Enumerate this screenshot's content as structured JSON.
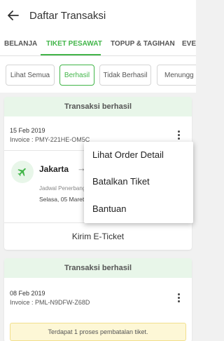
{
  "header": {
    "title": "Daftar Transaksi",
    "back_icon": "arrow-left-icon"
  },
  "tabs": [
    {
      "label": "BELANJA",
      "active": false
    },
    {
      "label": "TIKET PESAWAT",
      "active": true
    },
    {
      "label": "TOPUP & TAGIHAN",
      "active": false
    },
    {
      "label": "EVEN",
      "active": false
    }
  ],
  "filters": [
    {
      "label": "Lihat Semua",
      "active": false
    },
    {
      "label": "Berhasil",
      "active": true
    },
    {
      "label": "Tidak Berhasil",
      "active": false
    },
    {
      "label": "Menungg",
      "active": false
    }
  ],
  "transactions": [
    {
      "status": "Transaksi berhasil",
      "date": "15 Feb 2019",
      "invoice": "Invoice : PMY-221HE-OM5C",
      "city": "Jakarta",
      "arrow": "→",
      "schedule_label": "Jadwal Penerbangan",
      "departure": "Selasa, 05 Maret",
      "action": "Kirim E-Ticket"
    },
    {
      "status": "Transaksi berhasil",
      "date": "08 Feb 2019",
      "invoice": "Invoice : PML-N9DFW-Z68D",
      "notice": "Terdapat 1 proses pembatalan tiket."
    }
  ],
  "menu": {
    "items": [
      "Lihat Order Detail",
      "Batalkan Tiket",
      "Bantuan"
    ]
  },
  "colors": {
    "accent": "#42b549",
    "status_bg": "#e8f6e9",
    "notice_bg": "#fdf7d6"
  }
}
